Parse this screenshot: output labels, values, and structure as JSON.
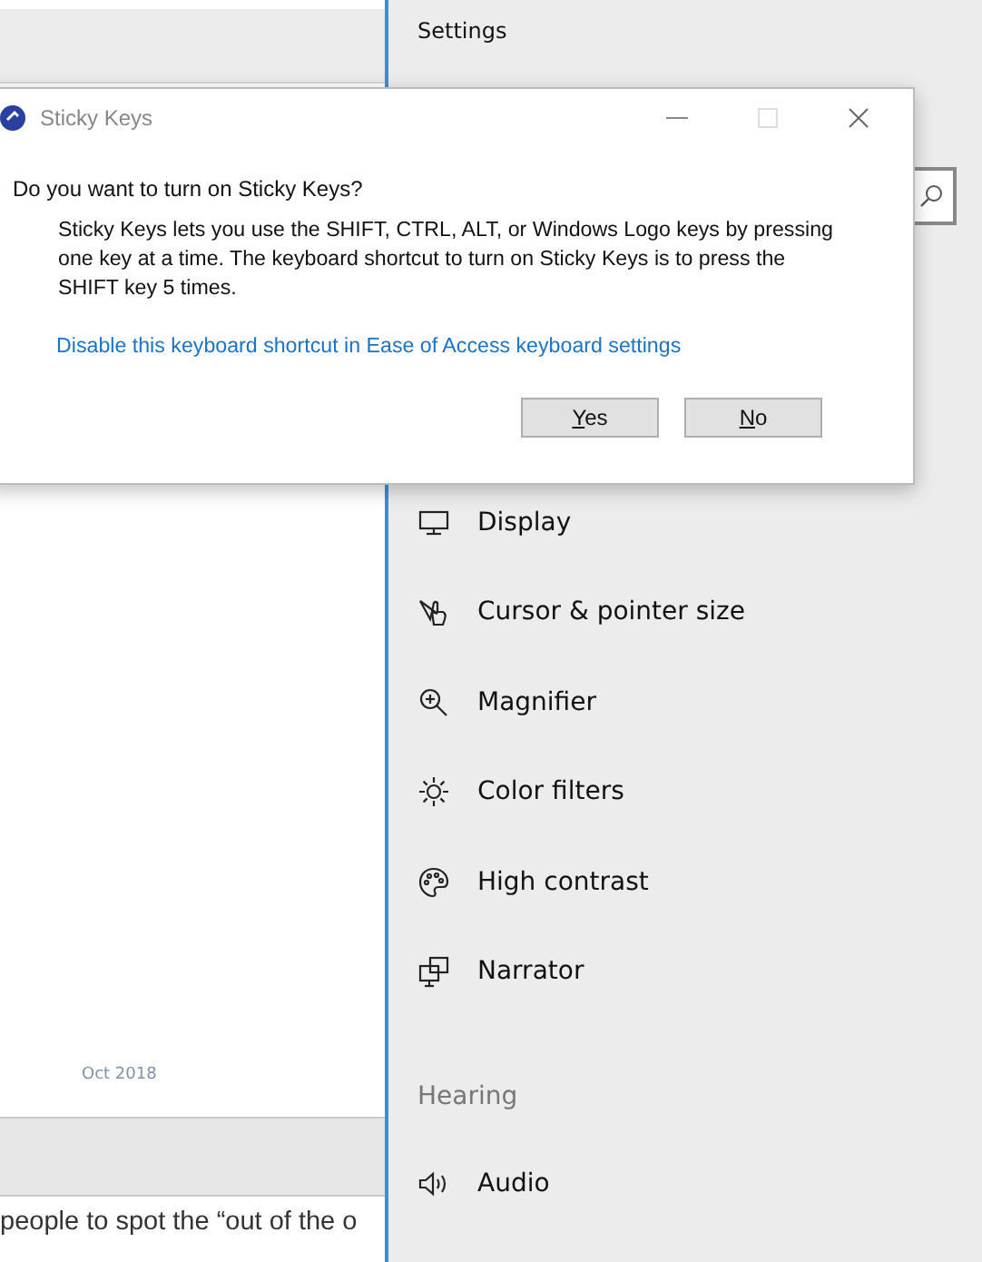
{
  "background_page": {
    "date": "Oct 2018",
    "text": "people to spot the “out of the o"
  },
  "settings": {
    "title": "Settings",
    "items": [
      {
        "label": "Display"
      },
      {
        "label": "Cursor & pointer size"
      },
      {
        "label": "Magnifier"
      },
      {
        "label": "Color filters"
      },
      {
        "label": "High contrast"
      },
      {
        "label": "Narrator"
      }
    ],
    "section": "Hearing",
    "section_items": [
      {
        "label": "Audio"
      }
    ]
  },
  "dialog": {
    "title": "Sticky Keys",
    "question": "Do you want to turn on Sticky Keys?",
    "body": "Sticky Keys lets you use the SHIFT, CTRL, ALT, or Windows Logo keys by pressing one key at a time. The keyboard shortcut to turn on Sticky Keys is to press the SHIFT key 5 times.",
    "link": "Disable this keyboard shortcut in Ease of Access keyboard settings",
    "buttons": [
      "Yes",
      "No"
    ]
  }
}
